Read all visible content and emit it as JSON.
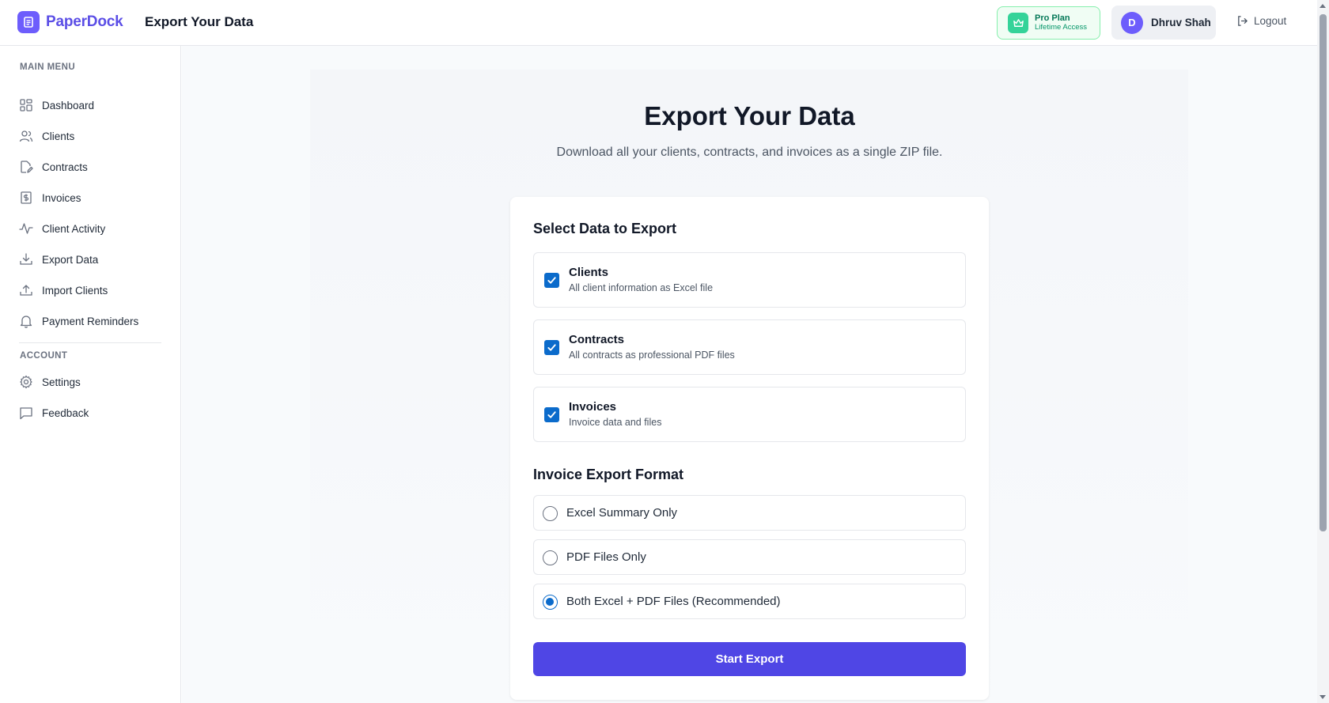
{
  "header": {
    "brand": "PaperDock",
    "title": "Export Your Data",
    "plan": {
      "title": "Pro Plan",
      "subtitle": "Lifetime Access"
    },
    "user": {
      "initial": "D",
      "name": "Dhruv Shah"
    },
    "logout_label": "Logout"
  },
  "sidebar": {
    "main_menu_label": "MAIN MENU",
    "items": [
      {
        "label": "Dashboard",
        "icon": "dashboard-icon"
      },
      {
        "label": "Clients",
        "icon": "users-icon"
      },
      {
        "label": "Contracts",
        "icon": "edit-document-icon"
      },
      {
        "label": "Invoices",
        "icon": "dollar-receipt-icon"
      },
      {
        "label": "Client Activity",
        "icon": "activity-icon"
      },
      {
        "label": "Export Data",
        "icon": "download-icon"
      },
      {
        "label": "Import Clients",
        "icon": "upload-icon"
      },
      {
        "label": "Payment Reminders",
        "icon": "bell-icon"
      }
    ],
    "account_label": "ACCOUNT",
    "account_items": [
      {
        "label": "Settings",
        "icon": "gear-icon"
      },
      {
        "label": "Feedback",
        "icon": "message-icon"
      }
    ]
  },
  "main": {
    "title": "Export Your Data",
    "subtitle": "Download all your clients, contracts, and invoices as a single ZIP file.",
    "select_heading": "Select Data to Export",
    "data_options": [
      {
        "title": "Clients",
        "description": "All client information as Excel file",
        "checked": true
      },
      {
        "title": "Contracts",
        "description": "All contracts as professional PDF files",
        "checked": true
      },
      {
        "title": "Invoices",
        "description": "Invoice data and files",
        "checked": true
      }
    ],
    "format_heading": "Invoice Export Format",
    "format_options": [
      {
        "label": "Excel Summary Only",
        "selected": false
      },
      {
        "label": "PDF Files Only",
        "selected": false
      },
      {
        "label": "Both Excel + PDF Files (Recommended)",
        "selected": true
      }
    ],
    "start_button": "Start Export"
  },
  "colors": {
    "brand": "#5b4ee6",
    "accent_button": "#4f46e5",
    "checkbox": "#0b6bcb",
    "pro_badge_bg": "#f0fdf4",
    "pro_badge_text": "#047857"
  }
}
